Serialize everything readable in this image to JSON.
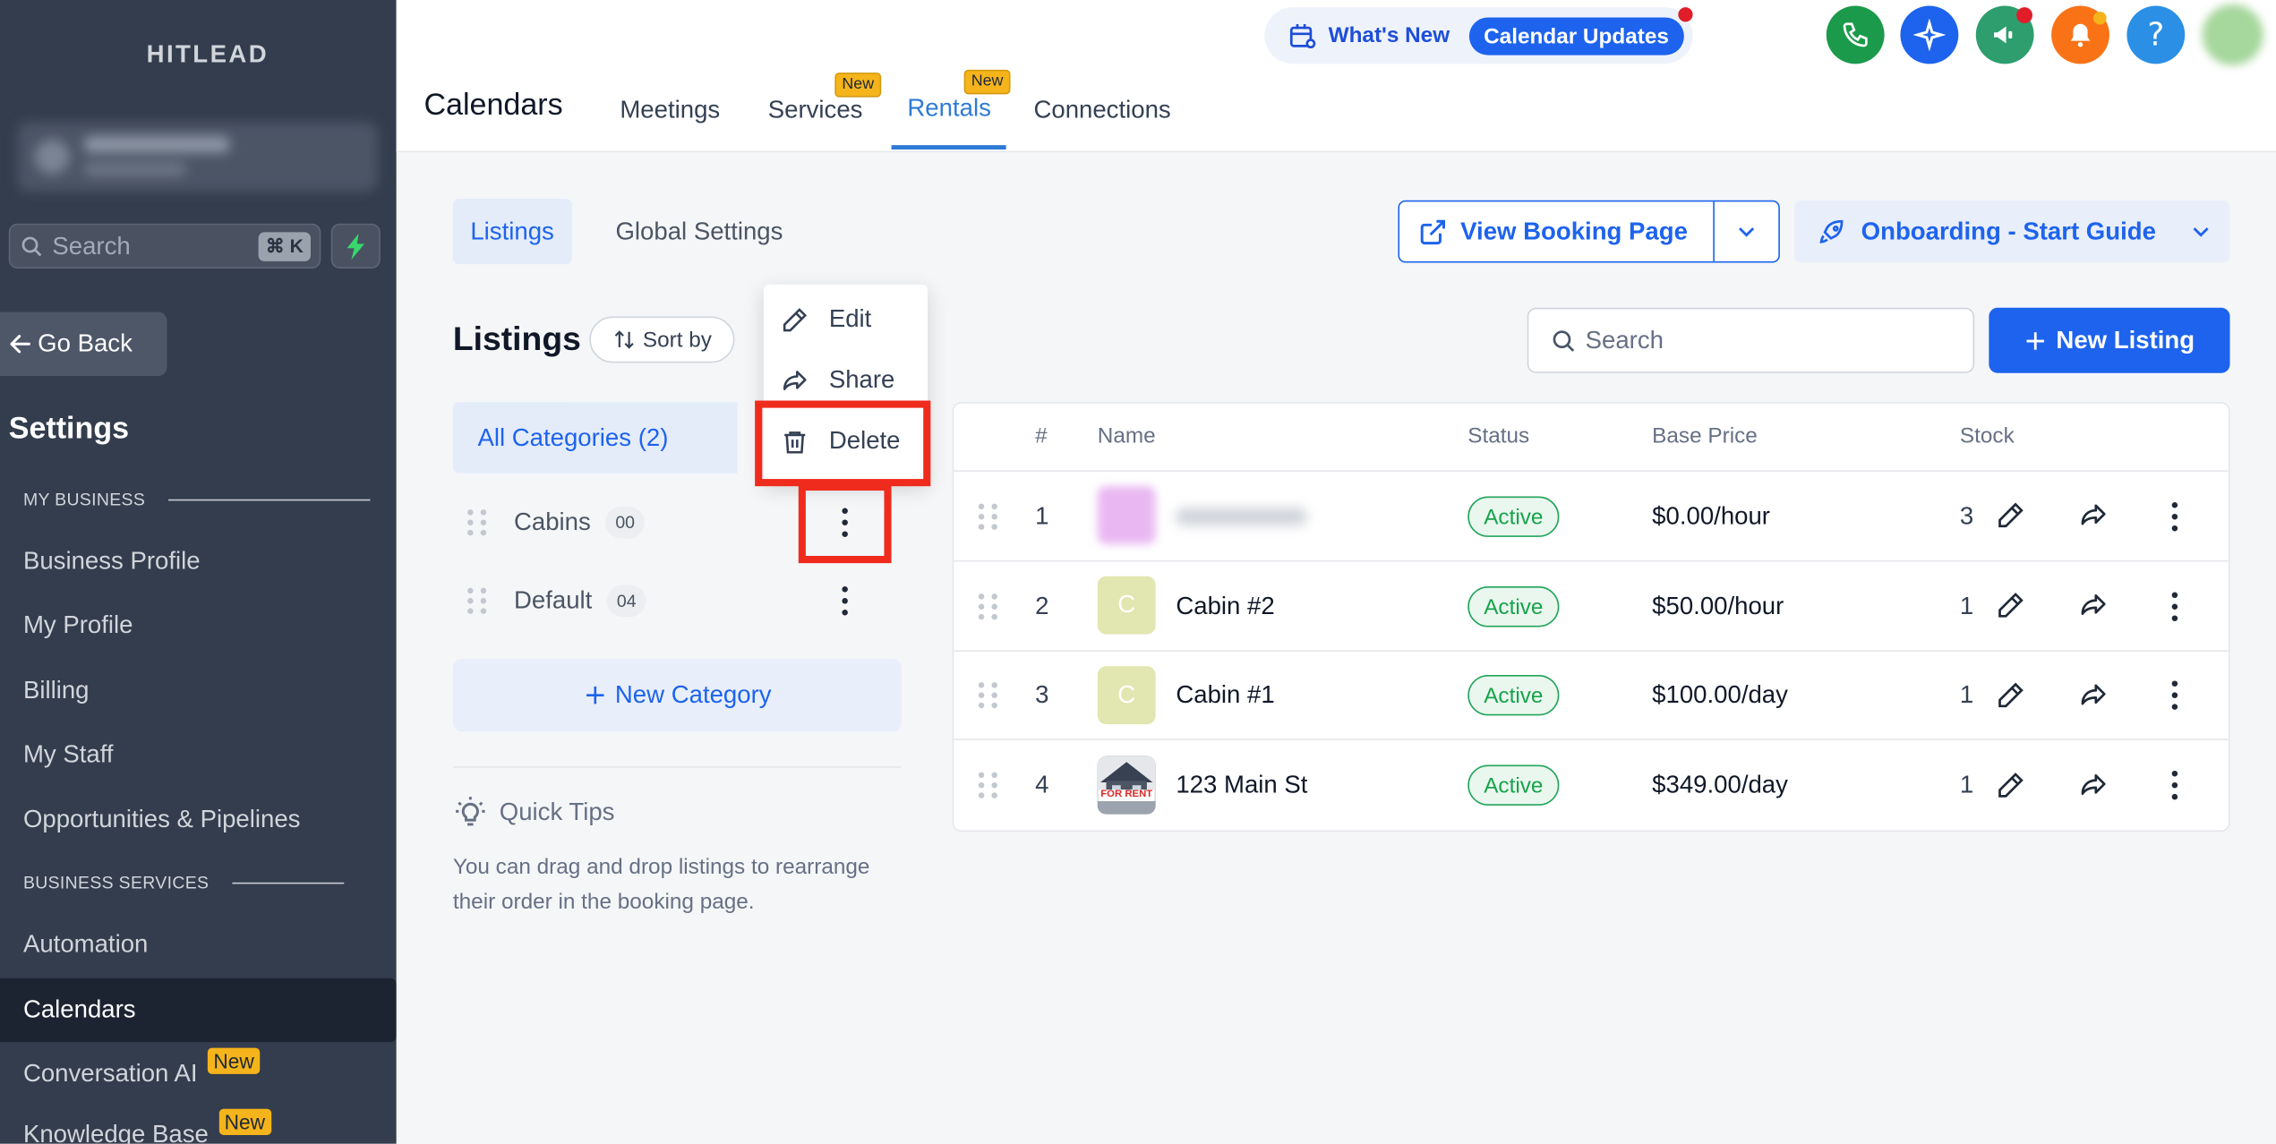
{
  "sidebar": {
    "brand": "HITLEAD",
    "search_placeholder": "Search",
    "search_shortcut": "⌘ K",
    "go_back": "Go Back",
    "settings_title": "Settings",
    "section_my_business": "MY BUSINESS",
    "section_business_services": "BUSINESS SERVICES",
    "items": [
      {
        "label": "Business Profile"
      },
      {
        "label": "My Profile"
      },
      {
        "label": "Billing"
      },
      {
        "label": "My Staff"
      },
      {
        "label": "Opportunities & Pipelines"
      },
      {
        "label": "Automation"
      },
      {
        "label": "Calendars",
        "active": true
      },
      {
        "label": "Conversation AI",
        "badge": "New"
      },
      {
        "label": "Knowledge Base",
        "badge": "New"
      }
    ]
  },
  "header": {
    "title": "Calendars",
    "tabs": [
      {
        "label": "Meetings"
      },
      {
        "label": "Services",
        "badge": "New"
      },
      {
        "label": "Rentals",
        "badge": "New",
        "active": true
      },
      {
        "label": "Connections"
      }
    ],
    "whats_new": "What's New",
    "calendar_updates": "Calendar Updates",
    "colors": {
      "phone": "#1c9a4b",
      "ai": "#1d63ed",
      "announce": "#2f9e6e",
      "bell": "#f97316",
      "help": "#2b8fe6"
    }
  },
  "content": {
    "subtabs": [
      {
        "label": "Listings",
        "active": true
      },
      {
        "label": "Global Settings"
      }
    ],
    "view_booking_page": "View Booking Page",
    "onboarding": "Onboarding - Start Guide",
    "listings_title": "Listings",
    "sort_by": "Sort by",
    "search_placeholder": "Search",
    "new_listing": "New Listing",
    "all_categories": "All Categories (2)",
    "categories": [
      {
        "name": "Cabins",
        "count": "00"
      },
      {
        "name": "Default",
        "count": "04"
      }
    ],
    "new_category": "New Category",
    "quick_tips_title": "Quick Tips",
    "quick_tips_body": "You can drag and drop listings to rearrange their order in the booking page."
  },
  "table": {
    "columns": [
      "#",
      "Name",
      "Status",
      "Base Price",
      "Stock"
    ],
    "rows": [
      {
        "num": "1",
        "name": "",
        "thumb": "",
        "status": "Active",
        "price": "$0.00/hour",
        "stock": "3"
      },
      {
        "num": "2",
        "name": "Cabin #2",
        "thumb": "C",
        "status": "Active",
        "price": "$50.00/hour",
        "stock": "1"
      },
      {
        "num": "3",
        "name": "Cabin #1",
        "thumb": "C",
        "status": "Active",
        "price": "$100.00/day",
        "stock": "1"
      },
      {
        "num": "4",
        "name": "123 Main St",
        "thumb_text": "FOR RENT",
        "status": "Active",
        "price": "$349.00/day",
        "stock": "1"
      }
    ]
  },
  "context_menu": {
    "items": [
      {
        "label": "Edit"
      },
      {
        "label": "Share"
      },
      {
        "label": "Delete",
        "highlighted": true
      }
    ]
  }
}
